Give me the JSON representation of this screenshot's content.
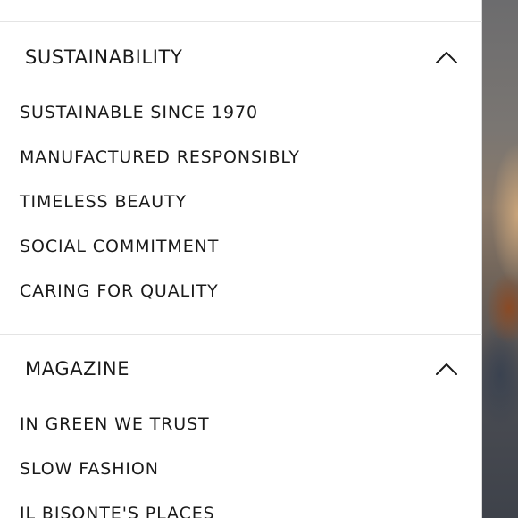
{
  "sections": [
    {
      "title": "SUSTAINABILITY",
      "toggle_icon": "chevron-up-icon",
      "items": [
        "SUSTAINABLE SINCE 1970",
        "MANUFACTURED RESPONSIBLY",
        "TIMELESS BEAUTY",
        "SOCIAL COMMITMENT",
        "CARING FOR QUALITY"
      ]
    },
    {
      "title": "MAGAZINE",
      "toggle_icon": "chevron-up-icon",
      "items": [
        "IN GREEN WE TRUST",
        "SLOW FASHION",
        "IL BISONTE'S PLACES"
      ]
    }
  ],
  "colors": {
    "text": "#1a1a1a",
    "divider": "#e4e4e4",
    "background": "#ffffff"
  }
}
